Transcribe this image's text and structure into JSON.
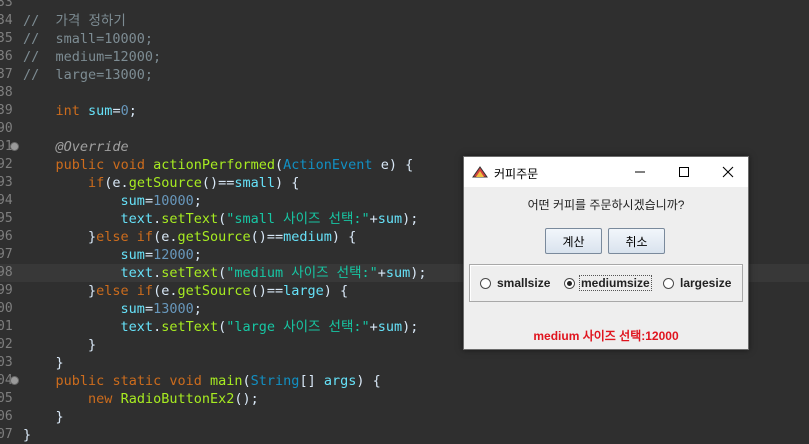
{
  "editor": {
    "lines": [
      {
        "num": "33",
        "fold": false,
        "hl": false,
        "tokens": []
      },
      {
        "num": "34",
        "fold": false,
        "hl": false,
        "tokens": [
          [
            "cm",
            "//  가격 정하기"
          ]
        ]
      },
      {
        "num": "35",
        "fold": false,
        "hl": false,
        "tokens": [
          [
            "cm",
            "//  small=10000;"
          ]
        ]
      },
      {
        "num": "36",
        "fold": false,
        "hl": false,
        "tokens": [
          [
            "cm",
            "//  medium=12000;"
          ]
        ]
      },
      {
        "num": "37",
        "fold": false,
        "hl": false,
        "tokens": [
          [
            "cm",
            "//  large=13000;"
          ]
        ]
      },
      {
        "num": "38",
        "fold": false,
        "hl": false,
        "tokens": []
      },
      {
        "num": "39",
        "fold": false,
        "hl": false,
        "tokens": [
          [
            "pl",
            "    "
          ],
          [
            "kw",
            "int"
          ],
          [
            "pl",
            " "
          ],
          [
            "vr",
            "sum"
          ],
          [
            "pl",
            "="
          ],
          [
            "nm",
            "0"
          ],
          [
            "pl",
            ";"
          ]
        ]
      },
      {
        "num": "90",
        "fold": false,
        "hl": false,
        "tokens": []
      },
      {
        "num": "91",
        "fold": true,
        "hl": false,
        "tokens": [
          [
            "pl",
            "    "
          ],
          [
            "an",
            "@Override"
          ]
        ]
      },
      {
        "num": "92",
        "fold": false,
        "hl": false,
        "tokens": [
          [
            "pl",
            "    "
          ],
          [
            "kw",
            "public"
          ],
          [
            "pl",
            " "
          ],
          [
            "kw",
            "void"
          ],
          [
            "pl",
            " "
          ],
          [
            "fn",
            "actionPerformed"
          ],
          [
            "pl",
            "("
          ],
          [
            "ty",
            "ActionEvent"
          ],
          [
            "pl",
            " e) {"
          ]
        ]
      },
      {
        "num": "93",
        "fold": false,
        "hl": false,
        "tokens": [
          [
            "pl",
            "        "
          ],
          [
            "kw",
            "if"
          ],
          [
            "pl",
            "(e."
          ],
          [
            "fn",
            "getSource"
          ],
          [
            "pl",
            "()=="
          ],
          [
            "vr",
            "small"
          ],
          [
            "pl",
            ") {"
          ]
        ]
      },
      {
        "num": "94",
        "fold": false,
        "hl": false,
        "tokens": [
          [
            "pl",
            "            "
          ],
          [
            "vr",
            "sum"
          ],
          [
            "pl",
            "="
          ],
          [
            "nm",
            "10000"
          ],
          [
            "pl",
            ";"
          ]
        ]
      },
      {
        "num": "95",
        "fold": false,
        "hl": false,
        "tokens": [
          [
            "pl",
            "            "
          ],
          [
            "vr",
            "text"
          ],
          [
            "pl",
            "."
          ],
          [
            "fn",
            "setText"
          ],
          [
            "pl",
            "("
          ],
          [
            "st",
            "\"small 사이즈 선택:\""
          ],
          [
            "pl",
            "+"
          ],
          [
            "vr",
            "sum"
          ],
          [
            "pl",
            ");"
          ]
        ]
      },
      {
        "num": "96",
        "fold": false,
        "hl": false,
        "tokens": [
          [
            "pl",
            "        }"
          ],
          [
            "kw",
            "else if"
          ],
          [
            "pl",
            "(e."
          ],
          [
            "fn",
            "getSource"
          ],
          [
            "pl",
            "()=="
          ],
          [
            "vr",
            "medium"
          ],
          [
            "pl",
            ") {"
          ]
        ]
      },
      {
        "num": "97",
        "fold": false,
        "hl": false,
        "tokens": [
          [
            "pl",
            "            "
          ],
          [
            "vr",
            "sum"
          ],
          [
            "pl",
            "="
          ],
          [
            "nm",
            "12000"
          ],
          [
            "pl",
            ";"
          ]
        ]
      },
      {
        "num": "98",
        "fold": false,
        "hl": true,
        "tokens": [
          [
            "pl",
            "            "
          ],
          [
            "vr",
            "text"
          ],
          [
            "pl",
            "."
          ],
          [
            "fn",
            "setText"
          ],
          [
            "pl",
            "("
          ],
          [
            "st",
            "\"medium 사이즈 선택:\""
          ],
          [
            "pl",
            "+"
          ],
          [
            "vr",
            "sum"
          ],
          [
            "pl",
            ");"
          ]
        ]
      },
      {
        "num": "99",
        "fold": false,
        "hl": false,
        "tokens": [
          [
            "pl",
            "        }"
          ],
          [
            "kw",
            "else if"
          ],
          [
            "pl",
            "(e."
          ],
          [
            "fn",
            "getSource"
          ],
          [
            "pl",
            "()=="
          ],
          [
            "vr",
            "large"
          ],
          [
            "pl",
            ") {"
          ]
        ]
      },
      {
        "num": "00",
        "fold": false,
        "hl": false,
        "tokens": [
          [
            "pl",
            "            "
          ],
          [
            "vr",
            "sum"
          ],
          [
            "pl",
            "="
          ],
          [
            "nm",
            "13000"
          ],
          [
            "pl",
            ";"
          ]
        ]
      },
      {
        "num": "01",
        "fold": false,
        "hl": false,
        "tokens": [
          [
            "pl",
            "            "
          ],
          [
            "vr",
            "text"
          ],
          [
            "pl",
            "."
          ],
          [
            "fn",
            "setText"
          ],
          [
            "pl",
            "("
          ],
          [
            "st",
            "\"large 사이즈 선택:\""
          ],
          [
            "pl",
            "+"
          ],
          [
            "vr",
            "sum"
          ],
          [
            "pl",
            ");"
          ]
        ]
      },
      {
        "num": "02",
        "fold": false,
        "hl": false,
        "tokens": [
          [
            "pl",
            "        }"
          ]
        ]
      },
      {
        "num": "03",
        "fold": false,
        "hl": false,
        "tokens": [
          [
            "pl",
            "    }"
          ]
        ]
      },
      {
        "num": "04",
        "fold": true,
        "hl": false,
        "tokens": [
          [
            "pl",
            "    "
          ],
          [
            "kw",
            "public"
          ],
          [
            "pl",
            " "
          ],
          [
            "kw",
            "static"
          ],
          [
            "pl",
            " "
          ],
          [
            "kw",
            "void"
          ],
          [
            "pl",
            " "
          ],
          [
            "fn",
            "main"
          ],
          [
            "pl",
            "("
          ],
          [
            "ty",
            "String"
          ],
          [
            "pl",
            "[] "
          ],
          [
            "vr",
            "args"
          ],
          [
            "pl",
            ") {"
          ]
        ]
      },
      {
        "num": "05",
        "fold": false,
        "hl": false,
        "tokens": [
          [
            "pl",
            "        "
          ],
          [
            "kw",
            "new"
          ],
          [
            "pl",
            " "
          ],
          [
            "fn",
            "RadioButtonEx2"
          ],
          [
            "pl",
            "();"
          ]
        ]
      },
      {
        "num": "06",
        "fold": false,
        "hl": false,
        "tokens": [
          [
            "pl",
            "    }"
          ]
        ]
      },
      {
        "num": "07",
        "fold": false,
        "hl": false,
        "tokens": [
          [
            "pl",
            "}"
          ]
        ]
      }
    ]
  },
  "dialog": {
    "title": "커피주문",
    "question": "어떤 커피를 주문하시겠습니까?",
    "buttons": {
      "calc": "계산",
      "cancel": "취소"
    },
    "radios": [
      {
        "label": "smallsize",
        "checked": false
      },
      {
        "label": "mediumsize",
        "checked": true
      },
      {
        "label": "largesize",
        "checked": false
      }
    ],
    "status_text": "medium 사이즈 선택:12000",
    "status_color": "#e0141e"
  }
}
